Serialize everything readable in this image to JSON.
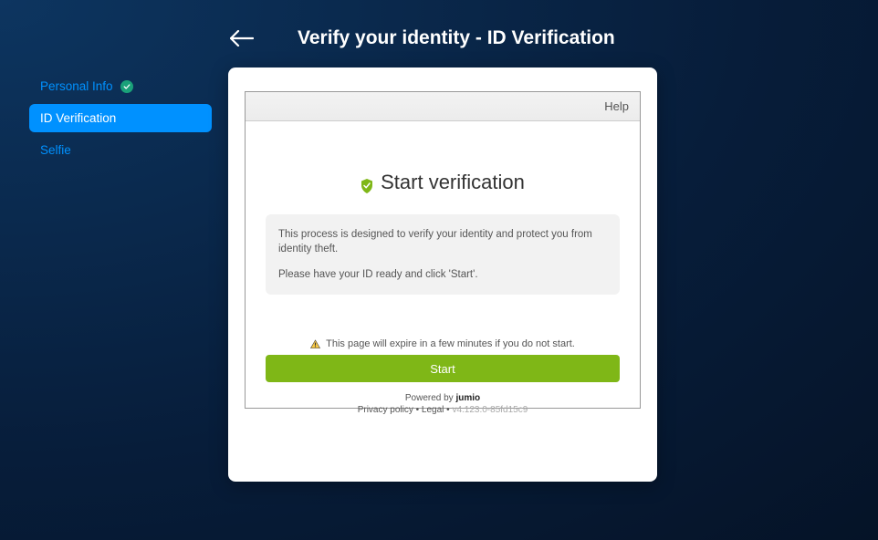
{
  "header": {
    "title": "Verify your identity - ID Verification"
  },
  "steps": {
    "personal_info": {
      "label": "Personal Info",
      "completed": true
    },
    "id_verification": {
      "label": "ID Verification",
      "active": true
    },
    "selfie": {
      "label": "Selfie"
    }
  },
  "frame": {
    "help_label": "Help",
    "heading": "Start verification",
    "info_line1": "This process is designed to verify your identity and protect you from identity theft.",
    "info_line2": "Please have your ID ready and click 'Start'.",
    "warning": "This page will expire in a few minutes if you do not start.",
    "start_label": "Start",
    "powered_by_prefix": "Powered by ",
    "powered_by_brand": "jumio",
    "privacy_label": "Privacy policy",
    "legal_label": "Legal",
    "version": "v4.123.0-85fd15c9"
  }
}
